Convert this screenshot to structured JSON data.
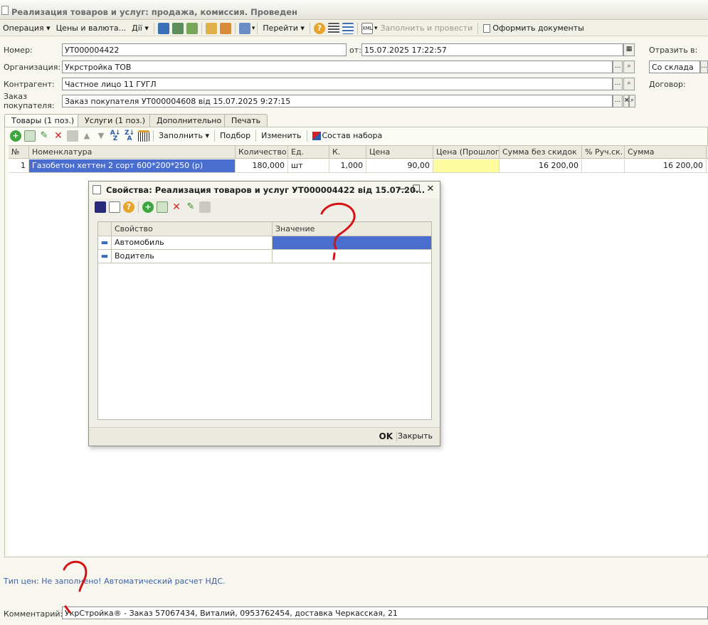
{
  "window": {
    "title": "Реализация товаров и услуг: продажа, комиссия. Проведен"
  },
  "toolbar": {
    "operation": "Операция",
    "prices": "Цены и валюта...",
    "actions": "Дії",
    "goto": "Перейти",
    "fill_and_post": "Заполнить и провести",
    "print_docs": "Оформить документы"
  },
  "header": {
    "number_label": "Номер:",
    "number": "УТ000004422",
    "date_label": "от:",
    "date": "15.07.2025 17:22:57",
    "reflect_label": "Отразить в:",
    "org_label": "Организация:",
    "org": "Укрстройка ТОВ",
    "warehouse": "Со склада",
    "contractor_label": "Контрагент:",
    "contractor": "Частное лицо 11 ГУГЛ",
    "contract_label": "Договор:",
    "order_label_1": "Заказ",
    "order_label_2": "покупателя:",
    "order": "Заказ покупателя УТ000004608 від 15.07.2025 9:27:15"
  },
  "tabs": [
    "Товары (1 поз.)",
    "Услуги (1 поз.)",
    "Дополнительно",
    "Печать"
  ],
  "grid_toolbar": {
    "fill": "Заполнить",
    "selection": "Подбор",
    "change": "Изменить",
    "set_composition": "Состав набора"
  },
  "grid": {
    "columns": [
      "№",
      "Номенклатура",
      "Количество",
      "Ед.",
      "К.",
      "Цена",
      "Цена (Прошлог...",
      "Сумма без скидок",
      "% Руч.ск.",
      "Сумма"
    ],
    "rows": [
      {
        "n": "1",
        "item": "Газобетон хеттен 2 сорт 600*200*250 (р)",
        "qty": "180,000",
        "unit": "шт",
        "k": "1,000",
        "price": "90,00",
        "price_prev": "",
        "sum_no_disc": "16 200,00",
        "manual_disc": "",
        "sum": "16 200,00"
      }
    ]
  },
  "dialog": {
    "title": "Свойства: Реализация товаров и услуг УТ000004422 від 15.07.20...",
    "columns": [
      "Свойство",
      "Значение"
    ],
    "rows": [
      {
        "property": "Автомобиль",
        "value": ""
      },
      {
        "property": "Водитель",
        "value": ""
      }
    ],
    "ok": "OK",
    "close": "Закрыть"
  },
  "footer": {
    "price_type": "Тип цен: Не заполнено!",
    "vat": "Автоматический расчет НДС.",
    "comment_label": "Комментарий:",
    "comment": "УкрСтройка® - Заказ 57067434, Виталий, 0953762454, доставка Черкасская, 21"
  },
  "colors": {
    "selection": "#4a6ed0",
    "highlight_cell": "#fdfda0",
    "link": "#3c5ea8",
    "annotation": "#d41414"
  }
}
